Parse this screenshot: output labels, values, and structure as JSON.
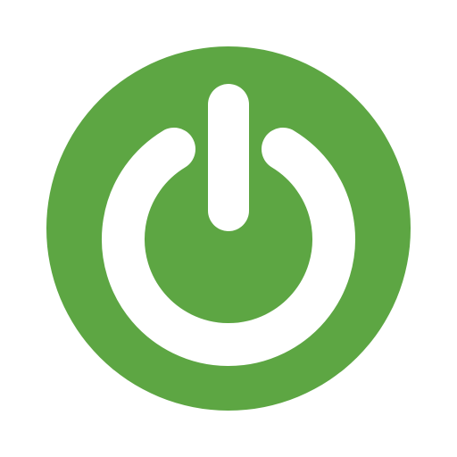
{
  "icon": {
    "name": "power-icon",
    "background_color": "#5da643",
    "glyph_color": "#ffffff",
    "page_background": "#ffffff"
  }
}
